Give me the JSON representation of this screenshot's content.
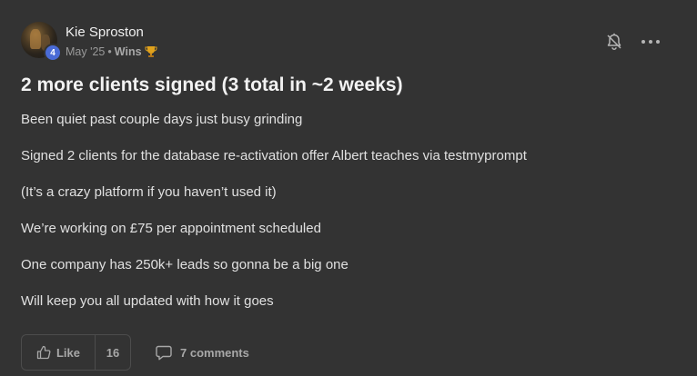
{
  "post": {
    "author": {
      "name": "Kie Sproston",
      "level": "4"
    },
    "meta": {
      "date": "May '25",
      "separator": "•",
      "category": "Wins",
      "category_icon": "trophy-icon"
    },
    "title": "2 more clients signed (3 total in ~2 weeks)",
    "body": [
      "Been quiet past couple days just busy grinding",
      "Signed 2 clients for the database re-activation offer Albert teaches via testmyprompt",
      "(It’s a crazy platform if you haven’t used it)",
      "We’re working on £75 per appointment scheduled",
      "One company has 250k+ leads so gonna be a big one",
      "Will keep you all updated with how it goes"
    ],
    "actions": {
      "like_label": "Like",
      "like_count": "16",
      "comments_label": "7 comments"
    }
  },
  "colors": {
    "background": "#333333",
    "level_badge": "#4a6bd6",
    "trophy": "#e0a21c"
  }
}
